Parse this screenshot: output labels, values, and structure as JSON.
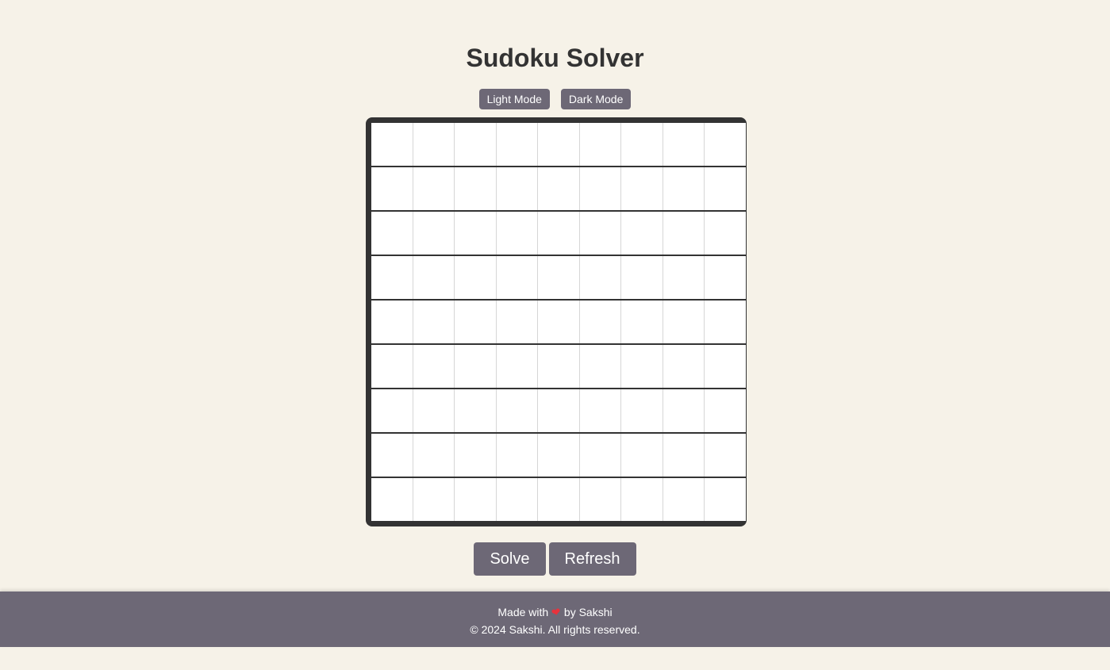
{
  "title": "Sudoku Solver",
  "modes": {
    "light_label": "Light Mode",
    "dark_label": "Dark Mode"
  },
  "board": {
    "size": 9,
    "values": [
      [
        "",
        "",
        "",
        "",
        "",
        "",
        "",
        "",
        ""
      ],
      [
        "",
        "",
        "",
        "",
        "",
        "",
        "",
        "",
        ""
      ],
      [
        "",
        "",
        "",
        "",
        "",
        "",
        "",
        "",
        ""
      ],
      [
        "",
        "",
        "",
        "",
        "",
        "",
        "",
        "",
        ""
      ],
      [
        "",
        "",
        "",
        "",
        "",
        "",
        "",
        "",
        ""
      ],
      [
        "",
        "",
        "",
        "",
        "",
        "",
        "",
        "",
        ""
      ],
      [
        "",
        "",
        "",
        "",
        "",
        "",
        "",
        "",
        ""
      ],
      [
        "",
        "",
        "",
        "",
        "",
        "",
        "",
        "",
        ""
      ],
      [
        "",
        "",
        "",
        "",
        "",
        "",
        "",
        "",
        ""
      ]
    ]
  },
  "actions": {
    "solve_label": "Solve",
    "refresh_label": "Refresh"
  },
  "footer": {
    "made_with": "Made with",
    "heart_icon": "heart-icon",
    "heart_glyph": "❤",
    "by": "by Sakshi",
    "copyright": "© 2024 Sakshi. All rights reserved."
  },
  "colors": {
    "background": "#f6f2e8",
    "button": "#6d6876",
    "board_border": "#333333",
    "heart": "#e8323c"
  }
}
